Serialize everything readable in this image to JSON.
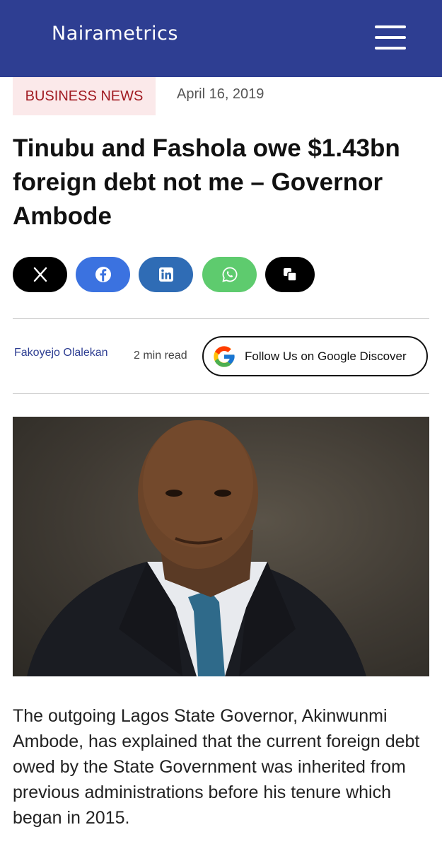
{
  "header": {
    "logo_text": "Nairametrics",
    "brand_color": "#2e3e92",
    "menu_icon": "hamburger-menu-icon"
  },
  "article": {
    "category": "BUSINESS NEWS",
    "date": "April 16, 2019",
    "title": "Tinubu and Fashola owe $1.43bn foreign debt not me – Governor Ambode",
    "author": "Fakoyejo Olalekan",
    "read_time": "2 min read",
    "follow_label": "Follow Us on Google Discover",
    "body": "The outgoing Lagos State Governor, Akinwunmi Ambode, has explained that the current foreign debt owed by the State Government was inherited from previous administrations before his tenure which began in 2015."
  },
  "share_buttons": [
    {
      "name": "x",
      "icon": "x-logo-icon",
      "color": "#000000"
    },
    {
      "name": "facebook",
      "icon": "facebook-icon",
      "color": "#3b72e0"
    },
    {
      "name": "linkedin",
      "icon": "linkedin-icon",
      "color": "#2f6cb5"
    },
    {
      "name": "whatsapp",
      "icon": "whatsapp-icon",
      "color": "#5ecb6e"
    },
    {
      "name": "copy",
      "icon": "copy-icon",
      "color": "#000000"
    }
  ]
}
